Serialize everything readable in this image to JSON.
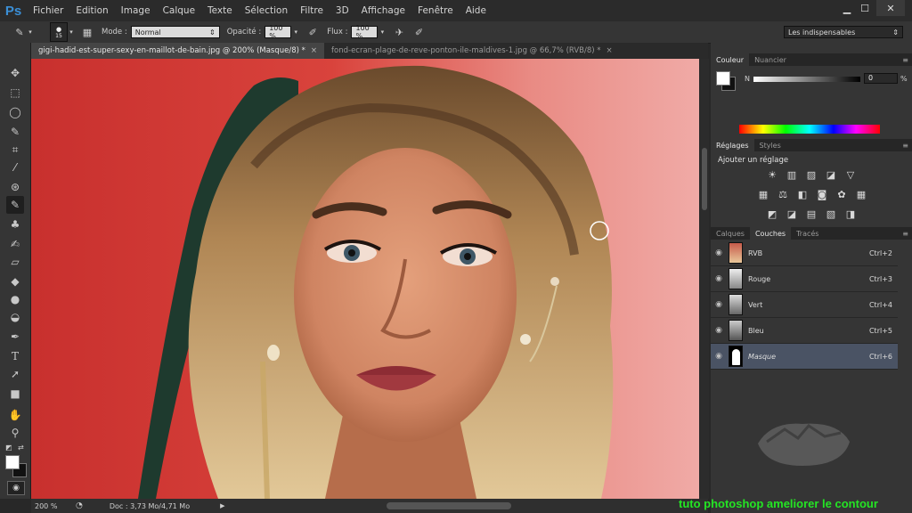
{
  "menubar": {
    "logo": "Ps",
    "items": [
      "Fichier",
      "Edition",
      "Image",
      "Calque",
      "Texte",
      "Sélection",
      "Filtre",
      "3D",
      "Affichage",
      "Fenêtre",
      "Aide"
    ],
    "window_controls": [
      "minimize-icon",
      "maximize-icon",
      "close-icon"
    ]
  },
  "options": {
    "brush_size": "15",
    "mode_label": "Mode :",
    "mode_value": "Normal",
    "opacity_label": "Opacité :",
    "opacity_value": "100 %",
    "flow_label": "Flux :",
    "flow_value": "100 %",
    "workspace_value": "Les indispensables"
  },
  "tools": [
    "move-icon",
    "marquee-icon",
    "lasso-icon",
    "quick-selection-icon",
    "crop-icon",
    "eyedropper-icon",
    "spot-healing-icon",
    "brush-icon",
    "clone-stamp-icon",
    "history-brush-icon",
    "eraser-icon",
    "paint-bucket-icon",
    "blur-icon",
    "dodge-icon",
    "pen-icon",
    "type-icon",
    "path-selection-icon",
    "shape-icon",
    "hand-icon",
    "zoom-icon"
  ],
  "doc_tabs": [
    {
      "label": "gigi-hadid-est-super-sexy-en-maillot-de-bain.jpg @ 200% (Masque/8) *",
      "active": true
    },
    {
      "label": "fond-ecran-plage-de-reve-ponton-ile-maldives-1.jpg @ 66,7% (RVB/8) *",
      "active": false
    }
  ],
  "status": {
    "zoom": "200 %",
    "doc_info": "Doc : 3,73 Mo/4,71 Mo"
  },
  "color_panel": {
    "tabs": [
      "Couleur",
      "Nuancier"
    ],
    "channel_label": "N",
    "value": "0",
    "unit": "%"
  },
  "adjust_panel": {
    "tabs": [
      "Réglages",
      "Styles"
    ],
    "title": "Ajouter un réglage"
  },
  "layers_panel": {
    "tabs": [
      "Calques",
      "Couches",
      "Tracés"
    ],
    "channels": [
      {
        "name": "RVB",
        "shortcut": "Ctrl+2"
      },
      {
        "name": "Rouge",
        "shortcut": "Ctrl+3"
      },
      {
        "name": "Vert",
        "shortcut": "Ctrl+4"
      },
      {
        "name": "Bleu",
        "shortcut": "Ctrl+5"
      },
      {
        "name": "Masque",
        "shortcut": "Ctrl+6"
      }
    ]
  },
  "caption": "tuto photoshop ameliorer le contour",
  "colors": {
    "canvas_bg": "#d23a36",
    "caption": "#24e524",
    "selected_row": "#4a5364"
  }
}
